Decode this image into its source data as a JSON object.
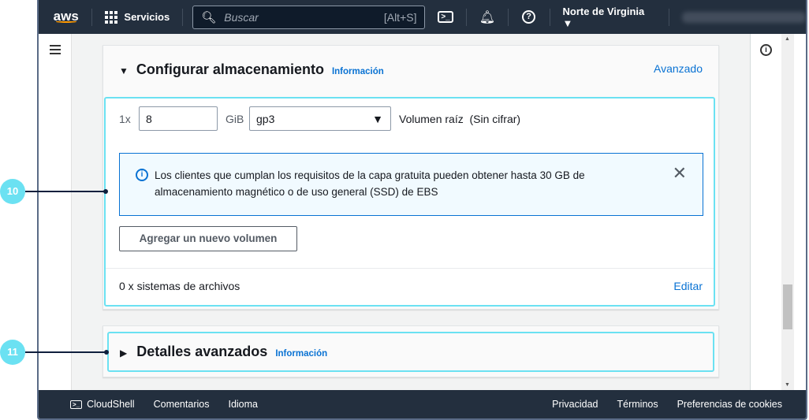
{
  "nav": {
    "logo": "aws",
    "services": "Servicios",
    "search_placeholder": "Buscar",
    "search_shortcut": "[Alt+S]",
    "region": "Norte de Virginia"
  },
  "storage": {
    "title": "Configurar almacenamiento",
    "info": "Información",
    "advanced": "Avanzado",
    "count": "1x",
    "size": "8",
    "unit": "GiB",
    "type": "gp3",
    "volume_label": "Volumen raíz  (Sin cifrar)",
    "alert_line1": "Los clientes que cumplan los requisitos de la capa gratuita pueden obtener hasta 30 GB de",
    "alert_line2": "almacenamiento magnético o de uso general (SSD) de EBS",
    "add_volume": "Agregar un nuevo volumen",
    "filesystems": "0 x sistemas de archivos",
    "edit": "Editar"
  },
  "advanced_details": {
    "title": "Detalles avanzados",
    "info": "Información"
  },
  "footer": {
    "cloudshell": "CloudShell",
    "comments": "Comentarios",
    "language": "Idioma",
    "privacy": "Privacidad",
    "terms": "Términos",
    "cookies": "Preferencias de cookies"
  },
  "callouts": [
    "10",
    "11"
  ]
}
